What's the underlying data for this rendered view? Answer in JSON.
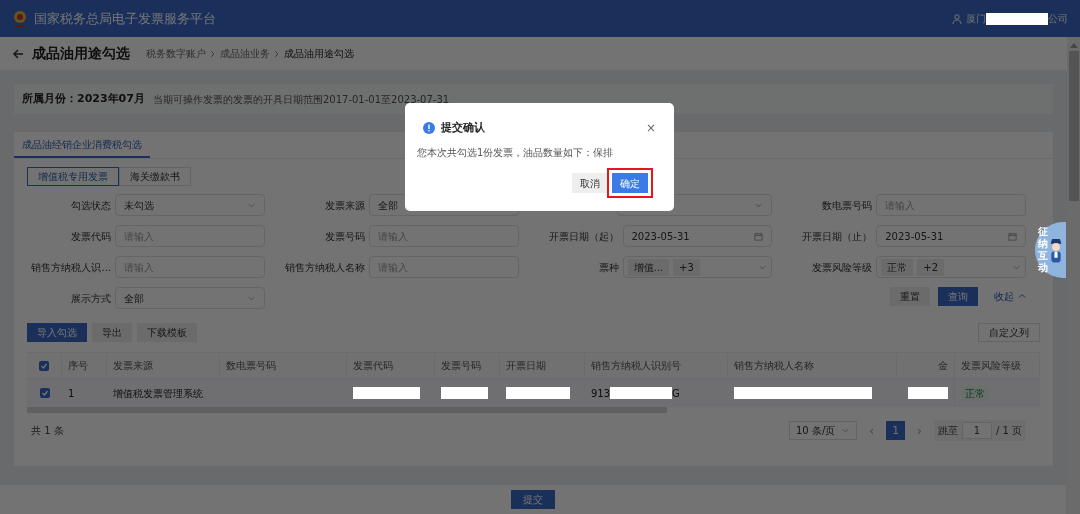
{
  "header": {
    "title": "国家税务总局电子发票服务平台",
    "user": [
      {
        "kind": "text",
        "text": "厦门"
      },
      {
        "kind": "redacted"
      },
      {
        "kind": "text",
        "text": "公司"
      }
    ]
  },
  "page": {
    "title": "成品油用途勾选",
    "breadcrumbs": [
      {
        "label": "税务数字账户",
        "current": false
      },
      {
        "label": "成品油业务",
        "current": false
      },
      {
        "label": "成品油用途勾选",
        "current": true
      }
    ]
  },
  "period": {
    "label": "所属月份：2023年07月",
    "note": "当期可操作发票的发票的开具日期范围2017-01-01至2023-07-31"
  },
  "tabs": [
    {
      "label": "成品油经销企业消费税勾选",
      "selected": true
    }
  ],
  "subtabs": [
    {
      "label": "增值税专用发票",
      "selected": true
    },
    {
      "label": "海关缴款书",
      "selected": false
    }
  ],
  "filters": [
    {
      "label": "勾选状态",
      "kind": "select",
      "value": "未勾选"
    },
    {
      "label": "发票来源",
      "kind": "select",
      "value": "全部"
    },
    {
      "kind": "select-hidden"
    },
    {
      "label": "数电票号码",
      "kind": "input",
      "placeholder": "请输入"
    },
    {
      "label": "发票代码",
      "kind": "input",
      "placeholder": "请输入"
    },
    {
      "label": "发票号码",
      "kind": "input",
      "placeholder": "请输入"
    },
    {
      "label": "开票日期（起）",
      "kind": "date",
      "value": "2023-05-31"
    },
    {
      "label": "开票日期（止）",
      "kind": "date",
      "value": "2023-05-31"
    },
    {
      "label": "销售方纳税人识...",
      "kind": "input",
      "placeholder": "请输入"
    },
    {
      "label": "销售方纳税人名称",
      "kind": "input",
      "placeholder": "请输入"
    },
    {
      "label": "票种",
      "kind": "tags",
      "tags": [
        "增值...",
        "+3"
      ]
    },
    {
      "label": "发票风险等级",
      "kind": "tags",
      "tags": [
        "正常",
        "+2"
      ]
    },
    {
      "label": "展示方式",
      "kind": "select",
      "value": "全部"
    }
  ],
  "filter_actions": {
    "reset": "重置",
    "query": "查询",
    "collapse": "收起"
  },
  "toolbar": {
    "buttons": [
      {
        "label": "导入勾选",
        "primary": true
      },
      {
        "label": "导出",
        "primary": false
      },
      {
        "label": "下载模板",
        "primary": false
      }
    ],
    "customize": "自定义列"
  },
  "table": {
    "all_checked": true,
    "columns": [
      "序号",
      "发票来源",
      "数电票号码",
      "发票代码",
      "发票号码",
      "开票日期",
      "销售方纳税人识别号",
      "销售方纳税人名称",
      "金",
      "发票风险等级"
    ],
    "rows": [
      {
        "checked": true,
        "cells": [
          [
            {
              "kind": "text",
              "text": "1"
            }
          ],
          [
            {
              "kind": "text",
              "text": "增值税发票管理系统"
            }
          ],
          [],
          [
            {
              "kind": "redacted"
            }
          ],
          [
            {
              "kind": "redacted"
            }
          ],
          [
            {
              "kind": "redacted"
            }
          ],
          [
            {
              "kind": "text",
              "text": "913"
            },
            {
              "kind": "redacted"
            },
            {
              "kind": "text",
              "text": "G"
            }
          ],
          [
            {
              "kind": "redacted"
            }
          ],
          [
            {
              "kind": "redacted"
            }
          ],
          [
            {
              "kind": "status",
              "text": "正常"
            }
          ]
        ]
      }
    ]
  },
  "pagination": {
    "total": "共 1 条",
    "page_size": "10 条/页",
    "prev": "‹",
    "pages": [
      {
        "label": "1",
        "selected": true
      }
    ],
    "next": "›",
    "jump_label": "跳至",
    "jump_value": "1",
    "page_count": "/ 1 页"
  },
  "submit": "提交",
  "widget": {
    "chars": [
      "征",
      "纳",
      "互",
      "动"
    ]
  },
  "dialog": {
    "title": "提交确认",
    "message": "您本次共勾选1份发票，油品数量如下：保排",
    "close": "×",
    "buttons": [
      {
        "label": "取消",
        "primary": false,
        "highlighted": false
      },
      {
        "label": "确定",
        "primary": true,
        "highlighted": true
      }
    ]
  }
}
